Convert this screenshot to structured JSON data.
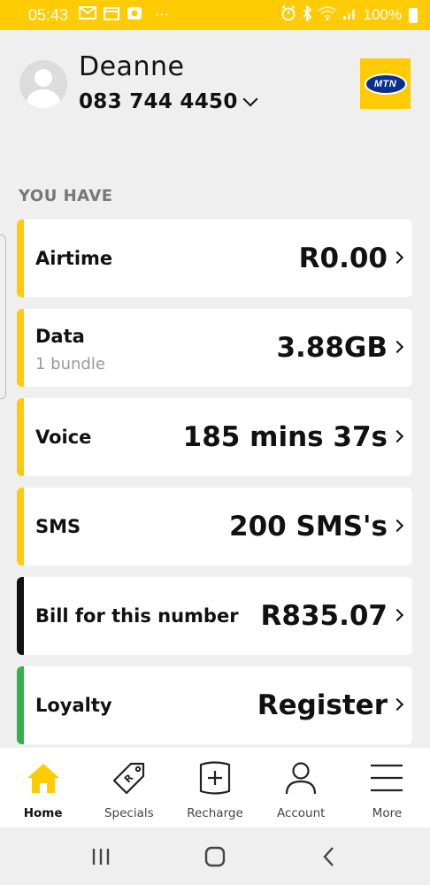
{
  "status_bar": {
    "time": "05:43",
    "dots": "···",
    "battery": "100%"
  },
  "header": {
    "name": "Deanne",
    "phone_number": "083 744 4450",
    "logo_text": "MTN"
  },
  "section_title": "YOU HAVE",
  "cards": [
    {
      "label": "Airtime",
      "value": "R0.00",
      "sub": "",
      "accent": "#ffcb05"
    },
    {
      "label": "Data",
      "value": "3.88GB",
      "sub": "1 bundle",
      "accent": "#ffcb05"
    },
    {
      "label": "Voice",
      "value": "185 mins 37s",
      "sub": "",
      "accent": "#ffcb05"
    },
    {
      "label": "SMS",
      "value": "200 SMS's",
      "sub": "",
      "accent": "#ffcb05"
    },
    {
      "label": "Bill for this number",
      "value": "R835.07",
      "sub": "",
      "accent": "#111111"
    },
    {
      "label": "Loyalty",
      "value": "Register",
      "sub": "",
      "accent": "#2fb34a"
    }
  ],
  "bottom_nav": [
    {
      "label": "Home",
      "icon": "home-icon",
      "active": true
    },
    {
      "label": "Specials",
      "icon": "price-tag-icon",
      "active": false
    },
    {
      "label": "Recharge",
      "icon": "recharge-plus-icon",
      "active": false
    },
    {
      "label": "Account",
      "icon": "person-icon",
      "active": false
    },
    {
      "label": "More",
      "icon": "hamburger-menu-icon",
      "active": false
    }
  ],
  "colors": {
    "brand_yellow": "#ffcb05",
    "mtn_blue": "#0b2f8f",
    "loyalty_green": "#2fb34a"
  }
}
